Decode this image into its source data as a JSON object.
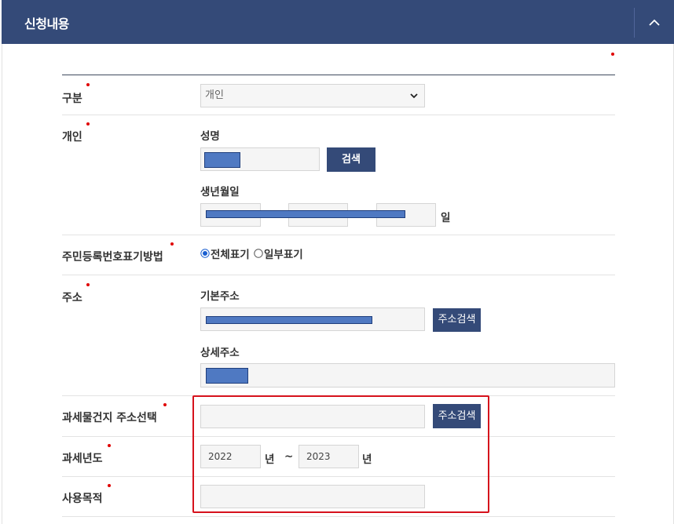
{
  "section": {
    "title": "신청내용",
    "toggle_icon": "chevron-up-icon"
  },
  "fields": {
    "category": {
      "label": "구분",
      "value": "개인"
    },
    "individual": {
      "label": "개인",
      "name_label": "성명",
      "search_button": "검색",
      "birth_label": "생년월일",
      "day_unit": "일"
    },
    "id_display": {
      "label": "주민등록번호표기방법",
      "options": [
        "전체표기",
        "일부표기"
      ],
      "selected": "전체표기"
    },
    "address": {
      "label": "주소",
      "basic_label": "기본주소",
      "search_button": "주소검색",
      "detail_label": "상세주소"
    },
    "tax_address": {
      "label": "과세물건지 주소선택",
      "search_button": "주소검색"
    },
    "tax_year": {
      "label": "과세년도",
      "from": "2022",
      "from_unit": "년",
      "separator": "~",
      "to": "2023",
      "to_unit": "년"
    },
    "purpose": {
      "label": "사용목적",
      "value": ""
    }
  },
  "colors": {
    "header_bg": "#344a78",
    "button_bg": "#344a78",
    "required_dot": "#e00000",
    "highlight_border": "#d6121c",
    "redaction": "#4f79c2"
  }
}
